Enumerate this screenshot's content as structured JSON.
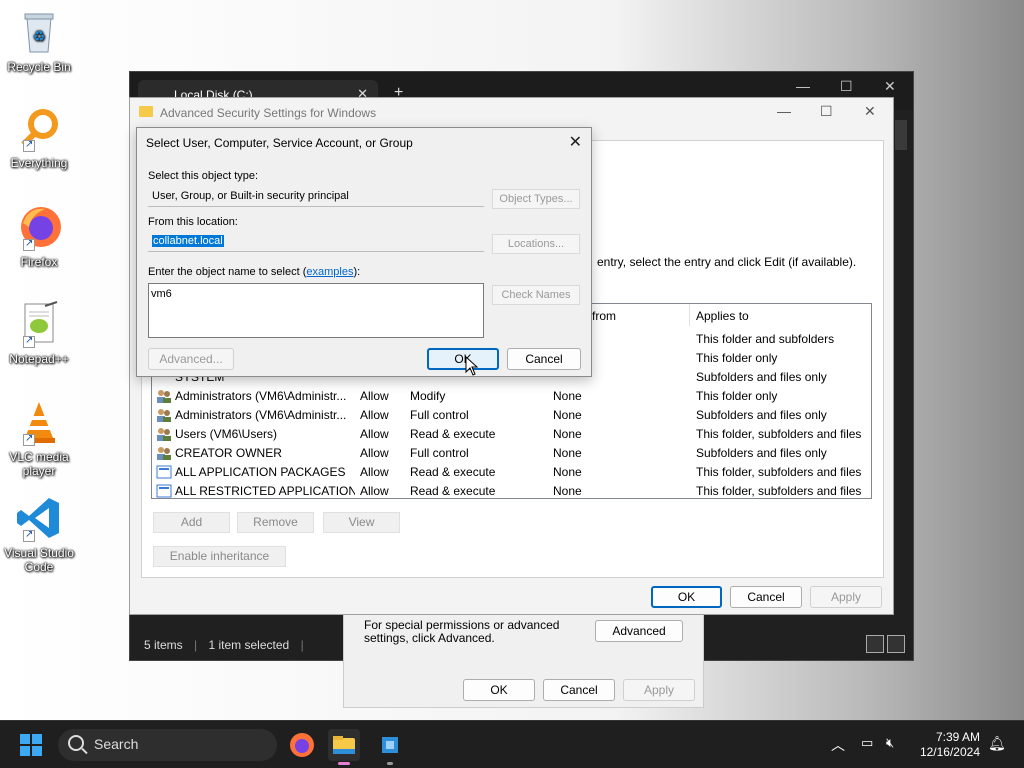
{
  "desktop": {
    "icons": [
      {
        "label": "Recycle Bin"
      },
      {
        "label": "Everything"
      },
      {
        "label": "Firefox"
      },
      {
        "label": "Notepad++"
      },
      {
        "label": "VLC media player"
      },
      {
        "label": "Visual Studio Code"
      }
    ]
  },
  "explorer": {
    "tab_title": "Local Disk (C:)",
    "status_items": "5 items",
    "status_selected": "1 item selected"
  },
  "properties": {
    "note": "For special permissions or advanced settings, click Advanced.",
    "advanced_label": "Advanced",
    "ok_label": "OK",
    "cancel_label": "Cancel",
    "apply_label": "Apply"
  },
  "advanced_security": {
    "title": "Advanced Security Settings for Windows",
    "instruction": "entry, select the entry and click Edit (if available).",
    "columns": {
      "inherited": "d from",
      "applies": "Applies to"
    },
    "rows": [
      {
        "principal": "",
        "access": "",
        "perm": "",
        "inherited": "",
        "applies": "This folder and subfolders"
      },
      {
        "principal": "",
        "access": "",
        "perm": "",
        "inherited": "",
        "applies": "This folder only"
      },
      {
        "principal": "SYSTEM",
        "access": "",
        "perm": "",
        "inherited": "",
        "applies": "Subfolders and files only"
      },
      {
        "principal": "Administrators (VM6\\Administr...",
        "access": "Allow",
        "perm": "Modify",
        "inherited": "None",
        "applies": "This folder only"
      },
      {
        "principal": "Administrators (VM6\\Administr...",
        "access": "Allow",
        "perm": "Full control",
        "inherited": "None",
        "applies": "Subfolders and files only"
      },
      {
        "principal": "Users (VM6\\Users)",
        "access": "Allow",
        "perm": "Read & execute",
        "inherited": "None",
        "applies": "This folder, subfolders and files"
      },
      {
        "principal": "CREATOR OWNER",
        "access": "Allow",
        "perm": "Full control",
        "inherited": "None",
        "applies": "Subfolders and files only"
      },
      {
        "principal": "ALL APPLICATION PACKAGES",
        "access": "Allow",
        "perm": "Read & execute",
        "inherited": "None",
        "applies": "This folder, subfolders and files"
      },
      {
        "principal": "ALL RESTRICTED APPLICATION ...",
        "access": "Allow",
        "perm": "Read & execute",
        "inherited": "None",
        "applies": "This folder, subfolders and files"
      }
    ],
    "add_label": "Add",
    "remove_label": "Remove",
    "view_label": "View",
    "enable_inheritance_label": "Enable inheritance",
    "ok_label": "OK",
    "cancel_label": "Cancel",
    "apply_label": "Apply"
  },
  "select_dialog": {
    "title": "Select User, Computer, Service Account, or Group",
    "object_type_label": "Select this object type:",
    "object_type_value": "User, Group, or Built-in security principal",
    "object_types_button": "Object Types...",
    "location_label": "From this location:",
    "location_value": "collabnet.local",
    "locations_button": "Locations...",
    "enter_label_prefix": "Enter the object name to select (",
    "examples_link": "examples",
    "enter_label_suffix": "):",
    "object_name_value": "vm6",
    "check_names_button": "Check Names",
    "advanced_button": "Advanced...",
    "ok_label": "OK",
    "cancel_label": "Cancel"
  },
  "taskbar": {
    "search_placeholder": "Search",
    "time": "7:39 AM",
    "date": "12/16/2024"
  },
  "colors": {
    "accent": "#0067c0",
    "link": "#0066cc",
    "selection": "#0078d7"
  }
}
